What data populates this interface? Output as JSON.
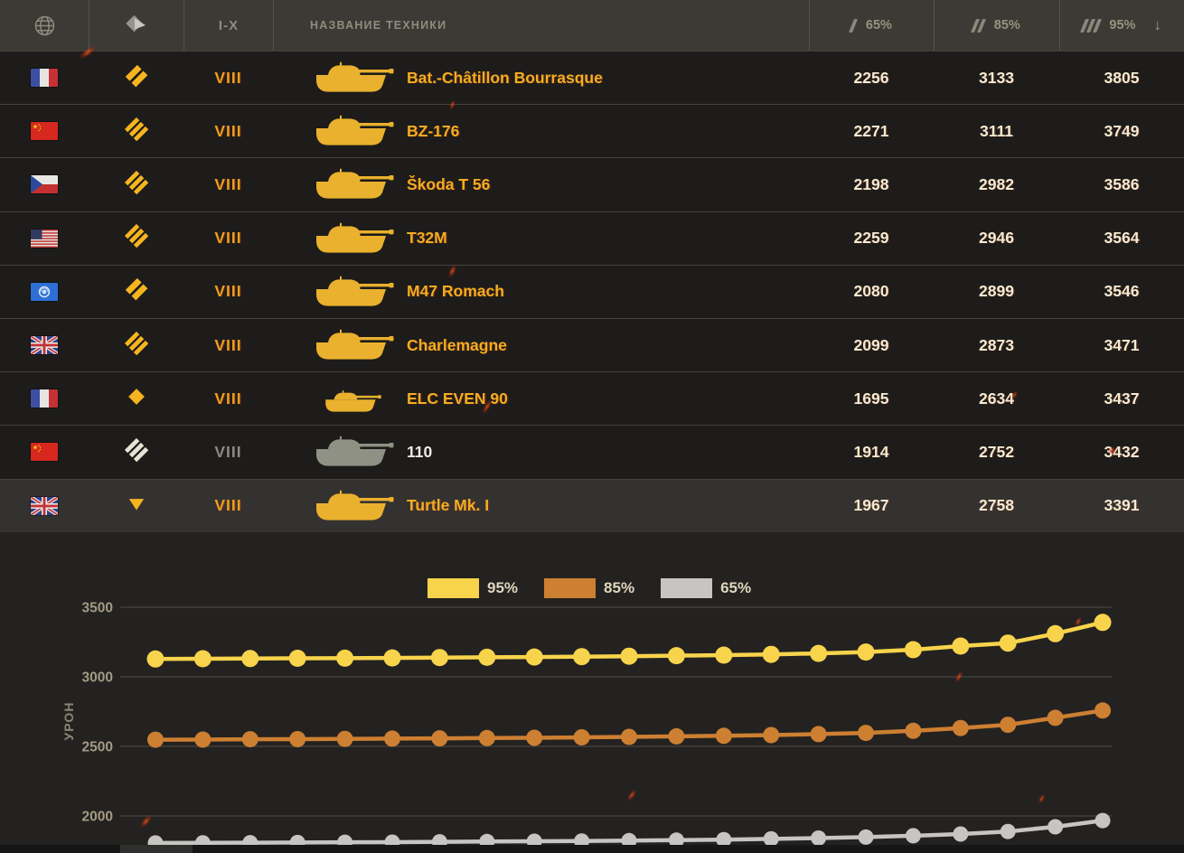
{
  "header": {
    "nation_column_icon": "globe-icon",
    "class_column_icon": "vehicle-class-filter-icon",
    "tier_label": "I-X",
    "name_label": "НАЗВАНИЕ ТЕХНИКИ",
    "col65": {
      "slash_count": 1,
      "label": "65%"
    },
    "col85": {
      "slash_count": 2,
      "label": "85%"
    },
    "col95": {
      "slash_count": 3,
      "label": "95%",
      "sort_arrow": "↓"
    }
  },
  "table": {
    "rows": [
      {
        "nation": "france",
        "class": "medium",
        "tier": "VIII",
        "name": "Bat.-Châtillon Bourrasque",
        "v65": "2256",
        "v85": "3133",
        "v95": "3805",
        "premium": true,
        "selected": false
      },
      {
        "nation": "china",
        "class": "heavy",
        "tier": "VIII",
        "name": "BZ-176",
        "v65": "2271",
        "v85": "3111",
        "v95": "3749",
        "premium": true,
        "selected": false
      },
      {
        "nation": "czech",
        "class": "heavy",
        "tier": "VIII",
        "name": "Škoda T 56",
        "v65": "2198",
        "v85": "2982",
        "v95": "3586",
        "premium": true,
        "selected": false
      },
      {
        "nation": "usa",
        "class": "heavy",
        "tier": "VIII",
        "name": "T32M",
        "v65": "2259",
        "v85": "2946",
        "v95": "3564",
        "premium": true,
        "selected": false
      },
      {
        "nation": "intl",
        "class": "medium",
        "tier": "VIII",
        "name": "M47 Romach",
        "v65": "2080",
        "v85": "2899",
        "v95": "3546",
        "premium": true,
        "selected": false
      },
      {
        "nation": "uk",
        "class": "heavy",
        "tier": "VIII",
        "name": "Charlemagne",
        "v65": "2099",
        "v85": "2873",
        "v95": "3471",
        "premium": true,
        "selected": false
      },
      {
        "nation": "france",
        "class": "light",
        "tier": "VIII",
        "name": "ELC EVEN 90",
        "v65": "1695",
        "v85": "2634",
        "v95": "3437",
        "premium": true,
        "selected": false
      },
      {
        "nation": "china",
        "class": "heavy",
        "tier": "VIII",
        "name": "110",
        "v65": "1914",
        "v85": "2752",
        "v95": "3432",
        "premium": false,
        "selected": false
      },
      {
        "nation": "uk",
        "class": "td",
        "tier": "VIII",
        "name": "Turtle Mk. I",
        "v65": "1967",
        "v85": "2758",
        "v95": "3391",
        "premium": true,
        "selected": true
      }
    ]
  },
  "chart_data": {
    "type": "line",
    "title": "",
    "xlabel": "",
    "ylabel": "УРОН",
    "yticks": [
      3500,
      3000,
      2500,
      2000
    ],
    "ylim": [
      1780,
      3560
    ],
    "grid": true,
    "legend_position": "top",
    "series": [
      {
        "name": "95%",
        "color": "#f8d44c",
        "values": [
          3128,
          3130,
          3131,
          3133,
          3134,
          3136,
          3138,
          3140,
          3142,
          3145,
          3148,
          3152,
          3156,
          3161,
          3168,
          3178,
          3195,
          3221,
          3242,
          3310,
          3391
        ]
      },
      {
        "name": "85%",
        "color": "#cd7f32",
        "values": [
          2548,
          2549,
          2551,
          2552,
          2554,
          2556,
          2558,
          2560,
          2562,
          2565,
          2568,
          2572,
          2576,
          2581,
          2588,
          2597,
          2612,
          2632,
          2655,
          2705,
          2758
        ]
      },
      {
        "name": "65%",
        "color": "#c6c5c3",
        "values": [
          1806,
          1807,
          1808,
          1809,
          1811,
          1812,
          1814,
          1816,
          1818,
          1820,
          1823,
          1826,
          1830,
          1835,
          1841,
          1848,
          1858,
          1870,
          1888,
          1922,
          1967
        ]
      }
    ]
  },
  "colors": {
    "gold_name": "#f2ae21",
    "gold_tier": "#ee9f1f",
    "gold_icon": "#f6b41f",
    "gold_silhouette": "#eab12e",
    "regular_name": "#edece6",
    "regular_icon": "#e6e4d6",
    "regular_silhouette": "#8e9184",
    "number_cream": "#f3ecd2",
    "header_bg": "#3b3a35",
    "row_bg": "#1d1c1a",
    "selected_row_bg": "#343230",
    "gridline": "#4f4d45",
    "tick_text": "#a29a84"
  }
}
